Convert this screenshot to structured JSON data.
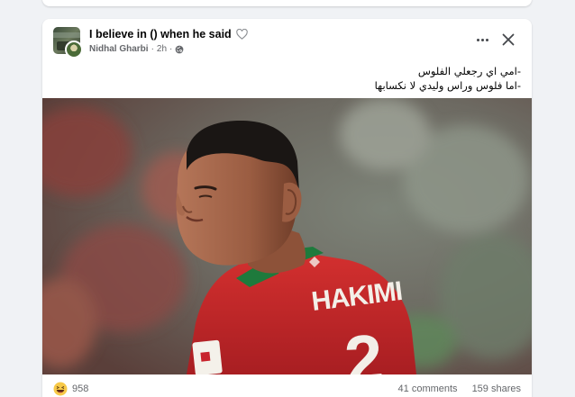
{
  "post": {
    "group_name": "I believe in () when he said",
    "author": "Nidhal Gharbi",
    "separator": "·",
    "time": "2h",
    "text_lines": [
      "-امي اي رجعلي الفلوس",
      "-اما فلوس وراس وليدي لا نكسابها"
    ],
    "photo": {
      "jersey_name": "HAKIMI",
      "jersey_number": "2"
    },
    "reaction_count": "958",
    "comments": "41 comments",
    "shares": "159 shares"
  },
  "icons": {
    "heart": "heart-outline-icon",
    "audience": "globe-icon",
    "more": "more-options-icon",
    "close": "close-icon",
    "reaction": "haha-reaction-icon"
  },
  "colors": {
    "jersey_red": "#c8232c",
    "jersey_green": "#1e7a3c",
    "meta_gray": "#65676b",
    "card_bg": "#ffffff",
    "page_bg": "#f0f2f5"
  }
}
